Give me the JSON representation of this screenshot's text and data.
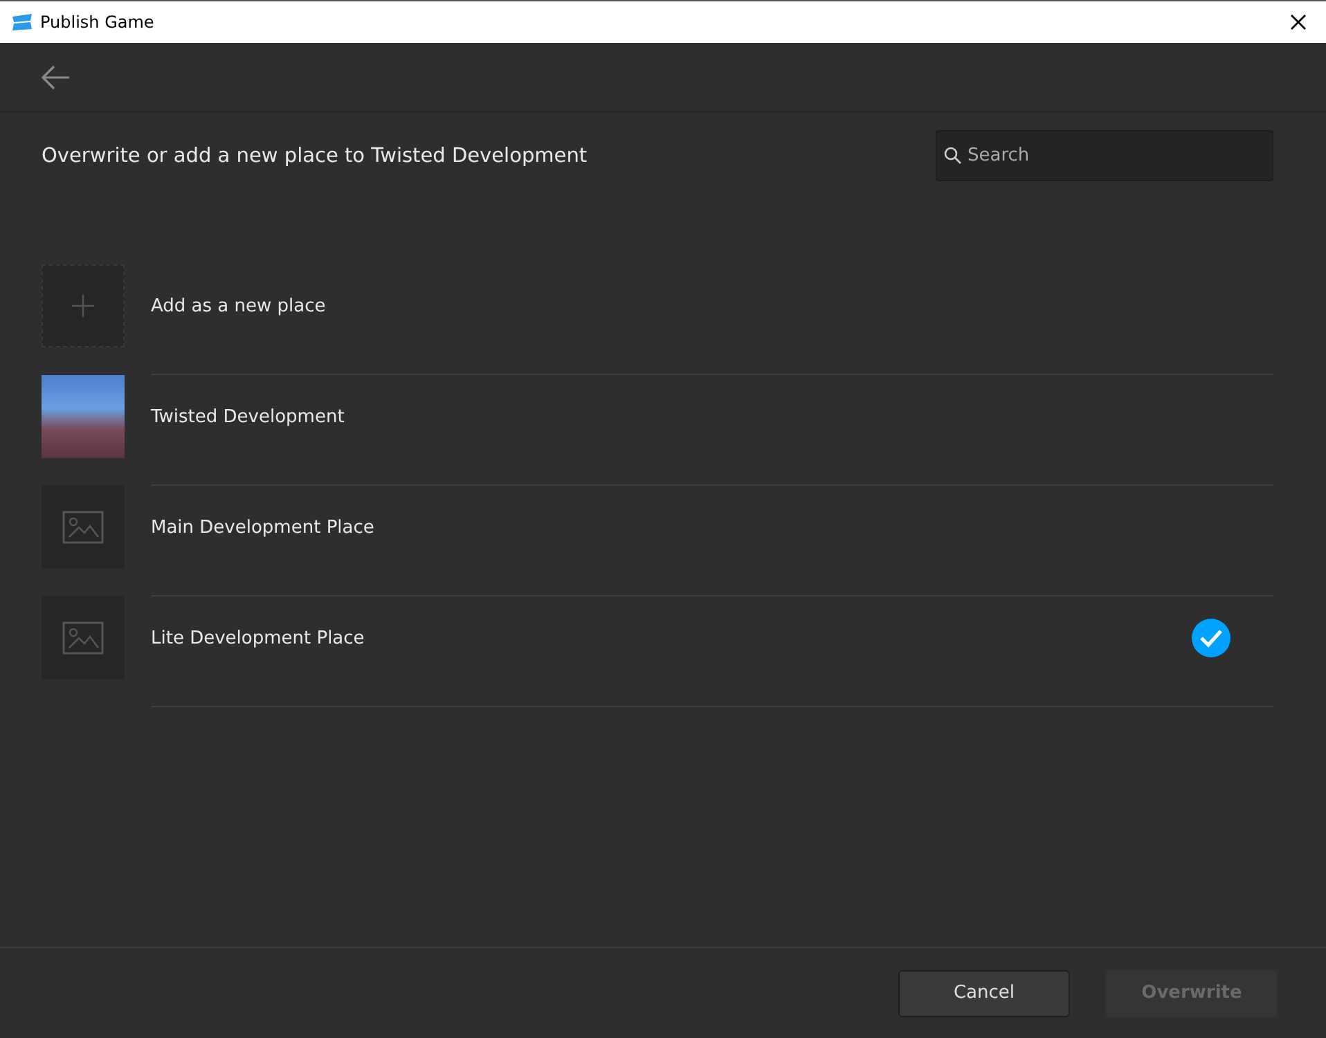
{
  "window": {
    "title": "Publish Game"
  },
  "heading": "Overwrite or add a new place to Twisted Development",
  "search": {
    "placeholder": "Search"
  },
  "places": [
    {
      "kind": "new",
      "name": "Add as a new place",
      "selected": false
    },
    {
      "kind": "photo",
      "name": "Twisted Development",
      "selected": false
    },
    {
      "kind": "placeholder",
      "name": "Main Development Place",
      "selected": false
    },
    {
      "kind": "placeholder",
      "name": "Lite Development Place",
      "selected": true
    }
  ],
  "buttons": [
    {
      "label": "Cancel",
      "disabled": false
    },
    {
      "label": "Overwrite",
      "disabled": true
    }
  ]
}
